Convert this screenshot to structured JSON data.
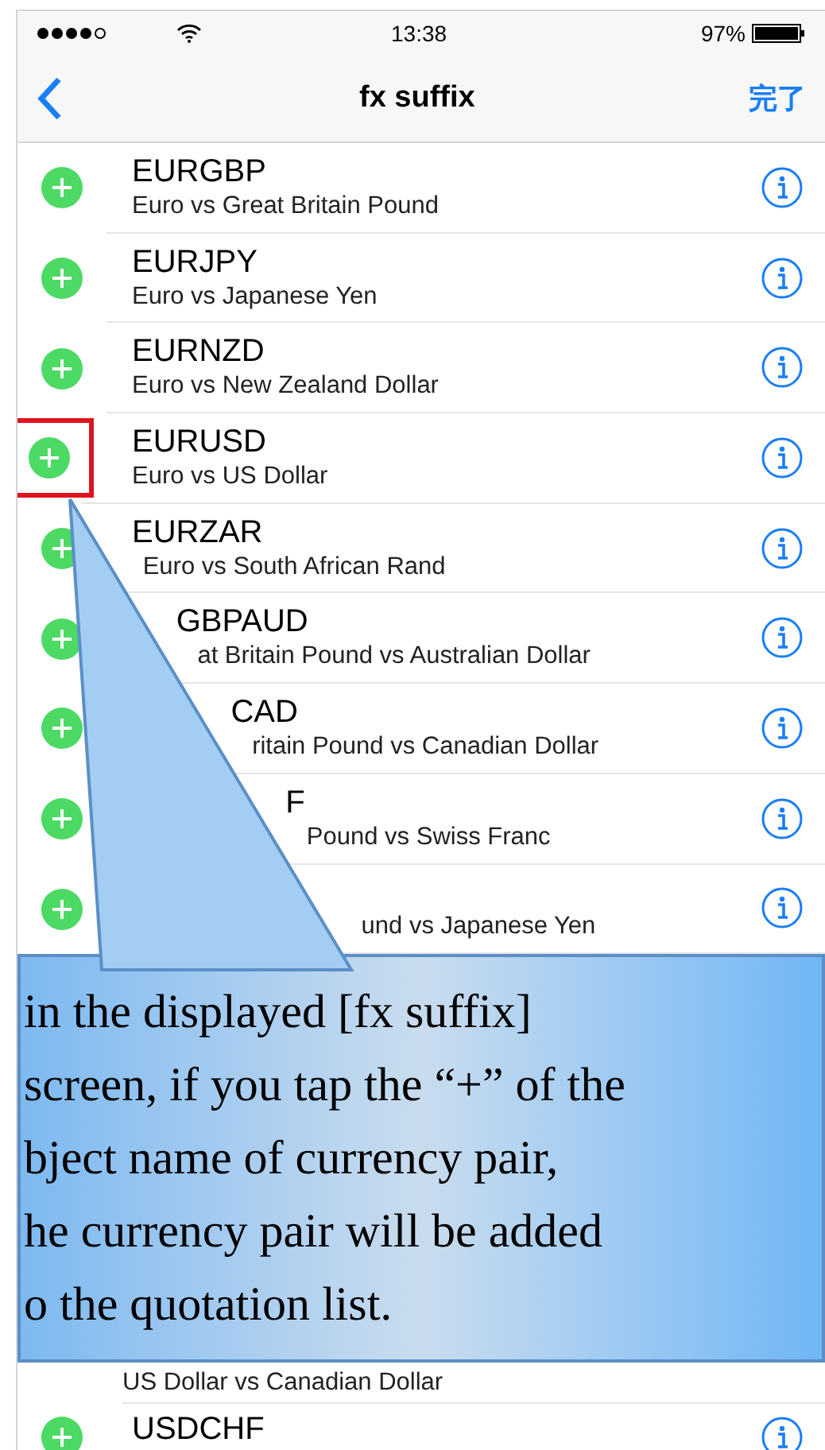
{
  "status_bar": {
    "time": "13:38",
    "battery": "97%"
  },
  "nav": {
    "title": "fx suffix",
    "done": "完了"
  },
  "rows": [
    {
      "title": "EURGBP",
      "subtitle": "Euro vs Great Britain Pound",
      "highlighted": false
    },
    {
      "title": "EURJPY",
      "subtitle": "Euro vs Japanese Yen",
      "highlighted": false
    },
    {
      "title": "EURNZD",
      "subtitle": "Euro vs New Zealand Dollar",
      "highlighted": false
    },
    {
      "title": "EURUSD",
      "subtitle": "Euro vs US Dollar",
      "highlighted": true
    },
    {
      "title": "EURZAR",
      "subtitle": "Euro vs South African Rand",
      "highlighted": false
    },
    {
      "title": "GBPAUD",
      "subtitle": "at Britain Pound vs Australian Dollar",
      "highlighted": false
    },
    {
      "title": "CAD",
      "subtitle": "ritain Pound vs Canadian Dollar",
      "highlighted": false
    },
    {
      "title": "F",
      "subtitle": "Pound vs Swiss Franc",
      "highlighted": false
    },
    {
      "subtitle": "und vs Japanese Yen",
      "highlighted": false
    }
  ],
  "callout": {
    "lines": [
      "in the displayed [fx suffix]",
      "screen, if you tap the “+” of the",
      "bject name of currency pair,",
      "he currency pair will be added",
      "o the quotation list."
    ]
  },
  "rows_below": [
    {
      "subtitle": "US Dollar vs Canadian Dollar"
    },
    {
      "title": "USDCHF"
    }
  ]
}
